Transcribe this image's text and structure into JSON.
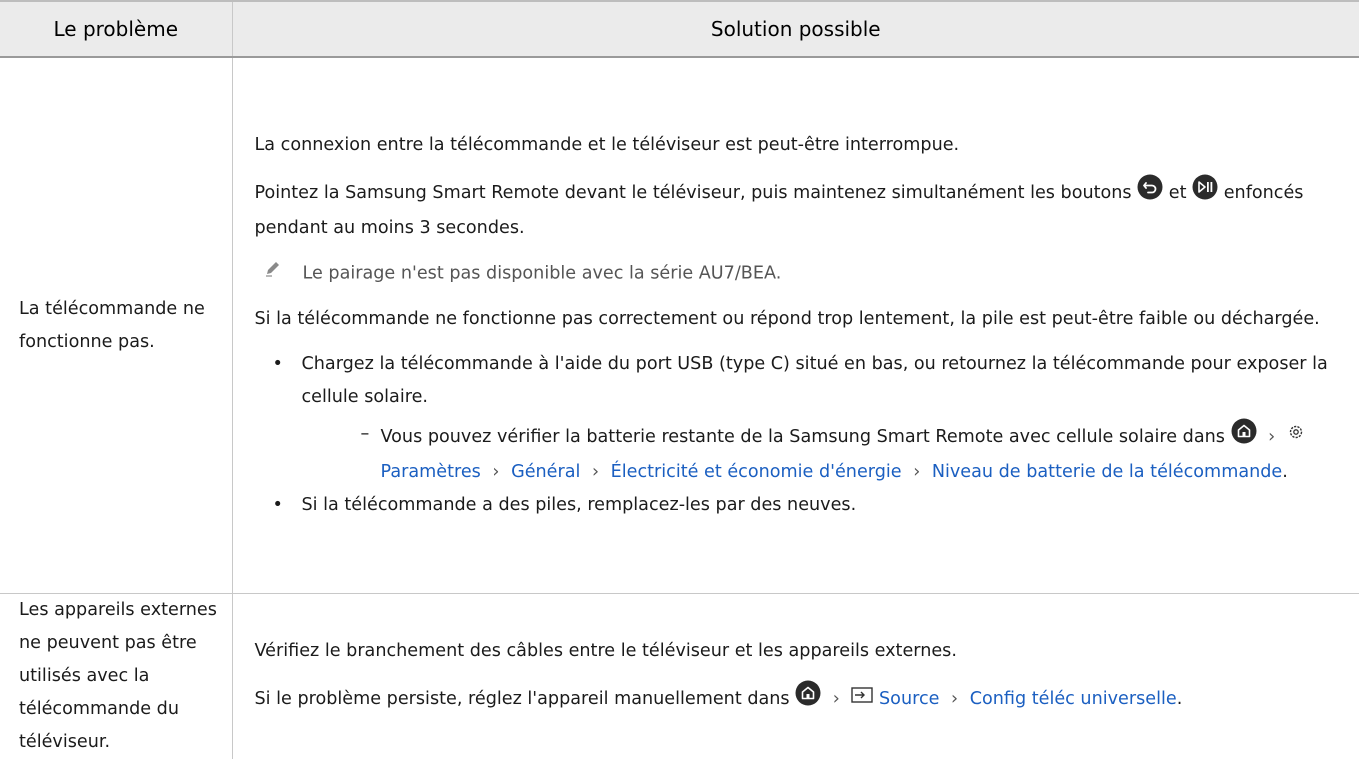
{
  "header": {
    "col_problem": "Le problème",
    "col_solution": "Solution possible"
  },
  "row1": {
    "problem": "La télécommande ne fonctionne pas.",
    "p1": "La connexion entre la télécommande et le téléviseur est peut-être interrompue.",
    "p2_a": "Pointez la Samsung Smart Remote devant le téléviseur, puis maintenez simultanément les boutons",
    "p2_b": "et",
    "p2_c": "enfoncés pendant au moins 3 secondes.",
    "note": "Le pairage n'est pas disponible avec la série AU7/BEA.",
    "p3": "Si la télécommande ne fonctionne pas correctement ou répond trop lentement, la pile est peut-être faible ou déchargée.",
    "bullet1": "Chargez la télécommande à l'aide du port USB (type C) situé en bas, ou retournez la télécommande pour exposer la cellule solaire.",
    "dash_symbol": "–",
    "sub1_text": "Vous pouvez vérifier la batterie restante de la Samsung Smart Remote avec cellule solaire dans",
    "path": [
      "Paramètres",
      "Général",
      "Électricité et économie d'énergie",
      "Niveau de batterie de la télécommande"
    ],
    "sub1_end": ".",
    "bullet2": "Si la télécommande a des piles, remplacez-les par des neuves."
  },
  "row2": {
    "problem": "Les appareils externes ne peuvent pas être utilisés avec la télécommande du téléviseur.",
    "p1": "Vérifiez le branchement des câbles entre le téléviseur et les appareils externes.",
    "p2_a": "Si le problème persiste, réglez l'appareil manuellement dans",
    "path": [
      "Source",
      "Config téléc universelle"
    ],
    "p2_end": "."
  },
  "chevron": "›",
  "icons": [
    "back-button-icon",
    "play-pause-button-icon",
    "pencil-note-icon",
    "home-icon",
    "gear-icon",
    "source-input-icon"
  ],
  "colors": {
    "header_bg": "#ebebeb",
    "link": "#1b5fc1",
    "border": "#c8c8c8"
  }
}
